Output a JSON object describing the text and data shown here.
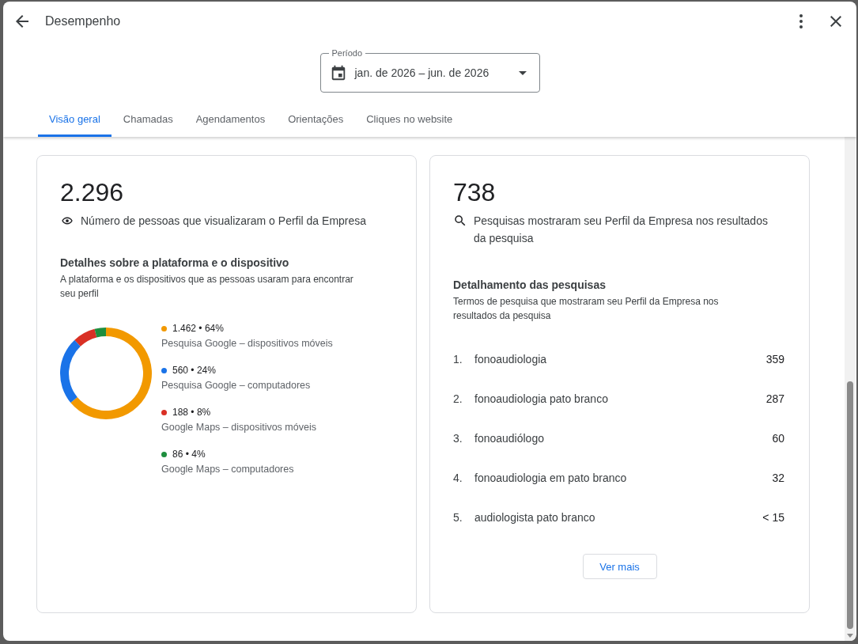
{
  "window": {
    "title": "Desempenho"
  },
  "period": {
    "label": "Período",
    "value": "jan. de 2026 – jun. de 2026"
  },
  "tabs": [
    {
      "label": "Visão geral",
      "selected": true
    },
    {
      "label": "Chamadas",
      "selected": false
    },
    {
      "label": "Agendamentos",
      "selected": false
    },
    {
      "label": "Orientações",
      "selected": false
    },
    {
      "label": "Cliques no website",
      "selected": false
    }
  ],
  "views_card": {
    "total": "2.296",
    "caption": "Número de pessoas que visualizaram o Perfil da Empresa",
    "section_title": "Detalhes sobre a plataforma e o dispositivo",
    "section_subtitle": "A plataforma e os dispositivos que as pessoas usaram para encontrar seu perfil",
    "chart_data": {
      "type": "donut",
      "values": [
        64,
        24,
        8,
        4
      ]
    },
    "legend": [
      {
        "figure": "1.462 • 64%",
        "label": "Pesquisa Google – dispositivos móveis",
        "color": "#f29900"
      },
      {
        "figure": "560 • 24%",
        "label": "Pesquisa Google – computadores",
        "color": "#1a73e8"
      },
      {
        "figure": "188 • 8%",
        "label": "Google Maps – dispositivos móveis",
        "color": "#d93025"
      },
      {
        "figure": "86 • 4%",
        "label": "Google Maps – computadores",
        "color": "#1e8e3e"
      }
    ]
  },
  "searches_card": {
    "total": "738",
    "caption": "Pesquisas mostraram seu Perfil da Empresa nos resultados da pesquisa",
    "section_title": "Detalhamento das pesquisas",
    "section_subtitle": "Termos de pesquisa que mostraram seu Perfil da Empresa nos resultados da pesquisa",
    "terms": [
      {
        "rank": "1.",
        "term": "fonoaudiologia",
        "count": "359"
      },
      {
        "rank": "2.",
        "term": "fonoaudiologia pato branco",
        "count": "287"
      },
      {
        "rank": "3.",
        "term": "fonoaudiólogo",
        "count": "60"
      },
      {
        "rank": "4.",
        "term": "fonoaudiologia em pato branco",
        "count": "32"
      },
      {
        "rank": "5.",
        "term": "audiologista pato branco",
        "count": "< 15"
      }
    ],
    "more_button": "Ver mais"
  }
}
